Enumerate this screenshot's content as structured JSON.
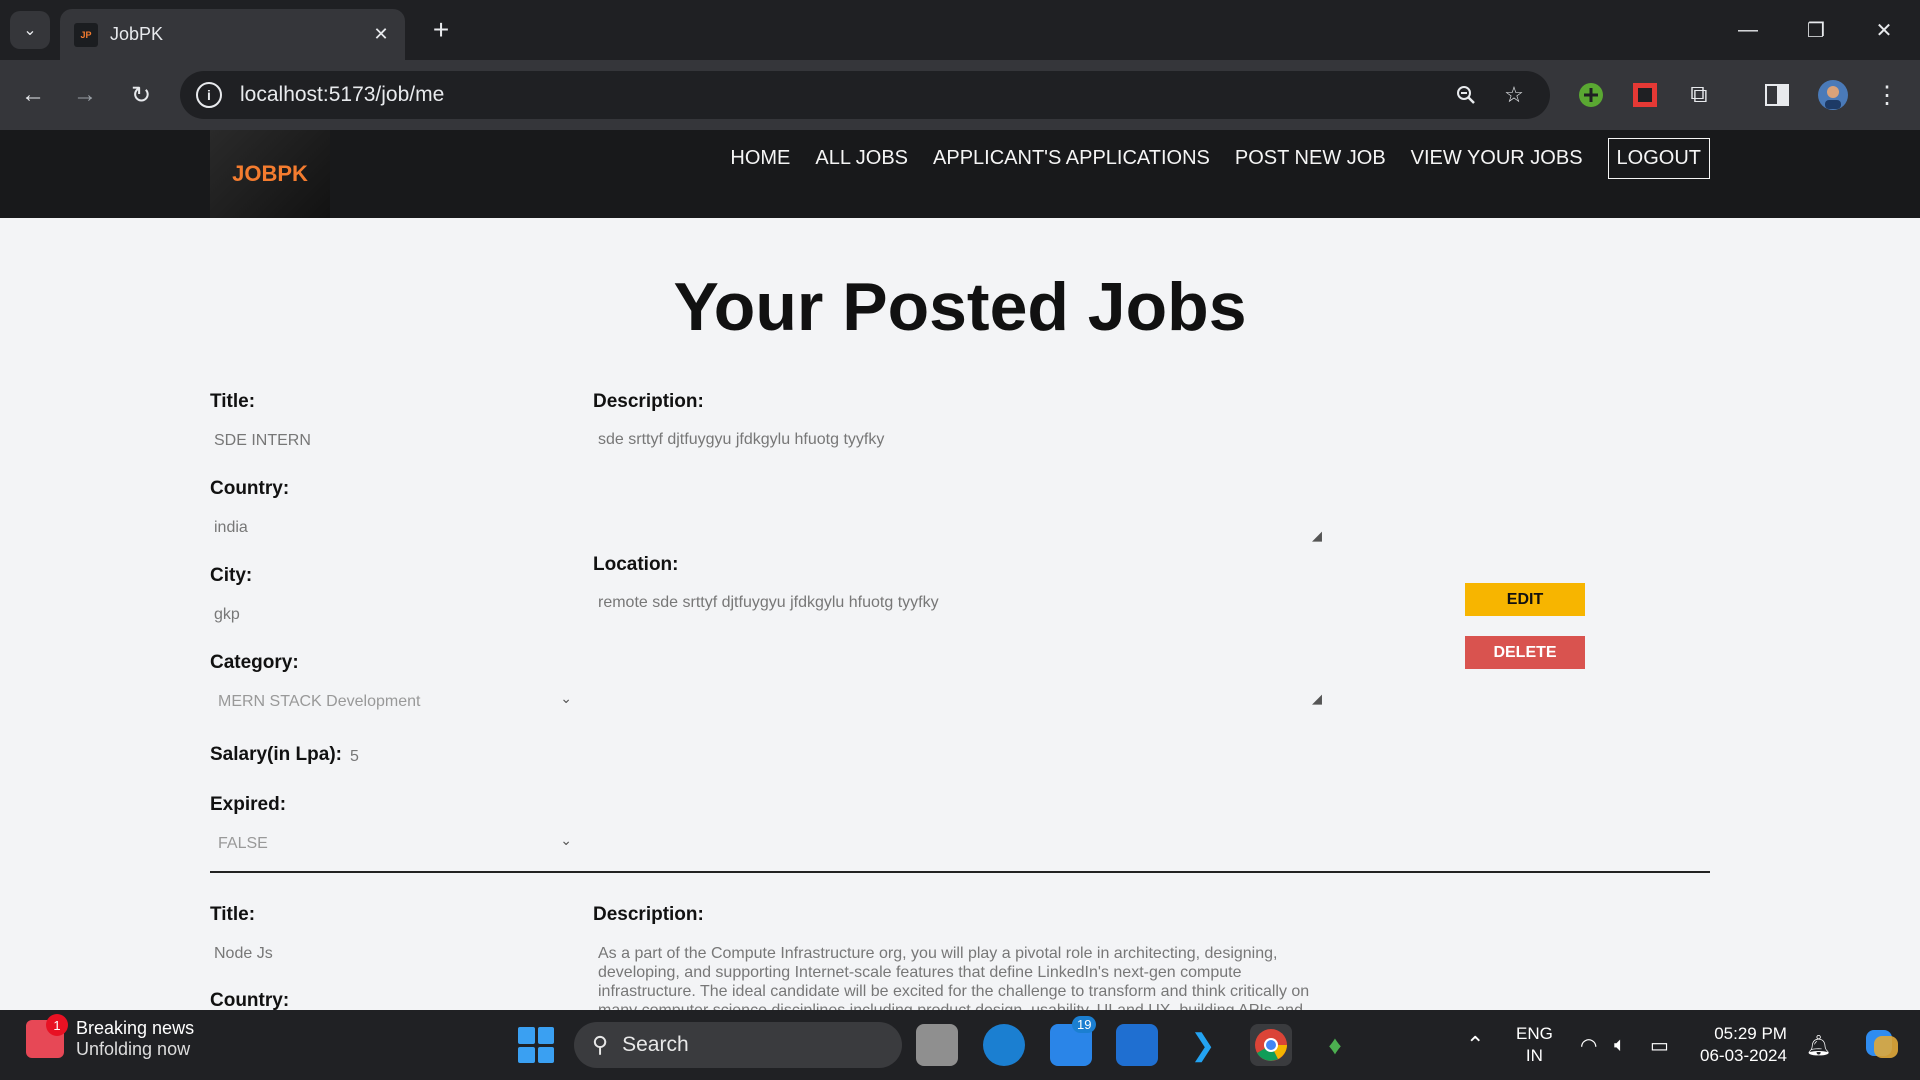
{
  "browser": {
    "tab_title": "JobPK",
    "url": "localhost:5173/job/me"
  },
  "site": {
    "logo_text": "JOBPK",
    "nav": {
      "home": "HOME",
      "all_jobs": "ALL JOBS",
      "applications": "APPLICANT'S APPLICATIONS",
      "post_job": "POST NEW JOB",
      "view_jobs": "VIEW YOUR JOBS",
      "logout": "LOGOUT"
    }
  },
  "page": {
    "title": "Your Posted Jobs",
    "labels": {
      "title": "Title:",
      "country": "Country:",
      "city": "City:",
      "category": "Category:",
      "salary": "Salary(in Lpa):",
      "expired": "Expired:",
      "description": "Description:",
      "location": "Location:"
    },
    "edit_label": "EDIT",
    "delete_label": "DELETE",
    "jobs": [
      {
        "title": "SDE INTERN",
        "country": "india",
        "city": "gkp",
        "category": "MERN STACK Development",
        "salary": "5",
        "expired": "FALSE",
        "description": "sde srttyf djtfuygyu jfdkgylu  hfuotg  tyyfky",
        "location": "remote sde srttyf djtfuygyu jfdkgylu  hfuotg  tyyfky"
      },
      {
        "title": "Node Js",
        "description": "As a part of the Compute Infrastructure org, you will play a pivotal role in architecting, designing, developing, and supporting Internet-scale features that define LinkedIn's next-gen compute infrastructure. The ideal candidate will be excited for the challenge to transform and think critically on many computer science disciplines including product design, usability, UI and UX, building APIs and"
      }
    ]
  },
  "taskbar": {
    "news_title": "Breaking news",
    "news_sub": "Unfolding now",
    "news_badge": "1",
    "search": "Search",
    "mail_badge": "19",
    "lang1": "ENG",
    "lang2": "IN",
    "time": "05:29 PM",
    "date": "06-03-2024"
  }
}
